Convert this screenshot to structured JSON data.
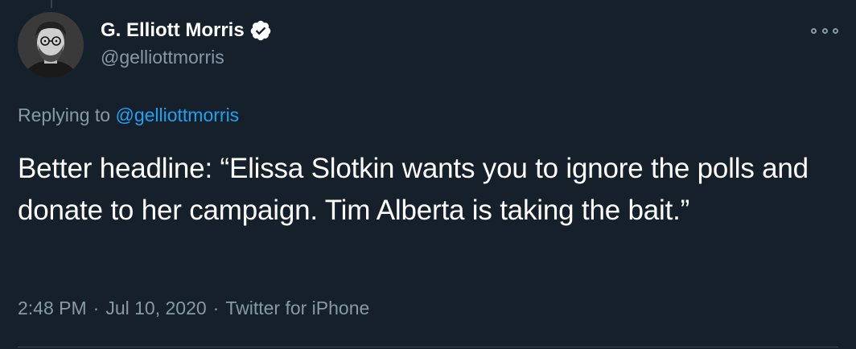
{
  "author": {
    "name": "G. Elliott Morris",
    "handle": "@gelliottmorris",
    "verified": true
  },
  "reply": {
    "prefix": "Replying to",
    "mention": "@gelliottmorris"
  },
  "tweet": {
    "text": "Better headline: “Elissa Slotkin wants you to ignore the polls and donate to her campaign. Tim Alberta is taking the bait.”"
  },
  "meta": {
    "time": "2:48 PM",
    "separator": "·",
    "date": "Jul 10, 2020",
    "source": "Twitter for iPhone"
  },
  "icons": {
    "verified": "verified-badge-icon",
    "more": "more-options-icon"
  },
  "colors": {
    "background": "#15202b",
    "text": "#ffffff",
    "secondary": "#8899a6",
    "link": "#1da1f2",
    "divider": "#38444d"
  }
}
